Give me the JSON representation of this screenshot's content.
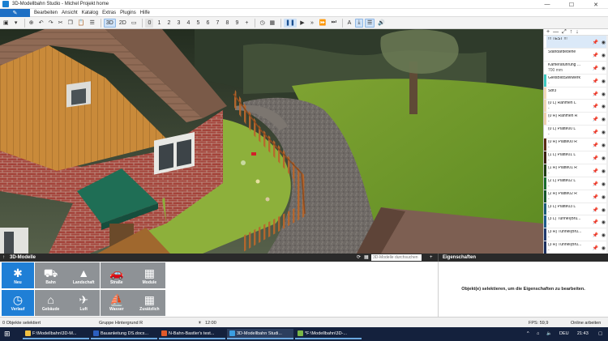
{
  "window": {
    "title": "3D-Modellbahn Studio - Michel Projekt home",
    "controls": [
      "—",
      "☐",
      "✕"
    ]
  },
  "menu": {
    "quick_icon": "pen-icon",
    "items": [
      "Bearbeiten",
      "Ansicht",
      "Katalog",
      "Extras",
      "Plugins",
      "Hilfe"
    ]
  },
  "toolbar": {
    "view_3d": "3D",
    "view_2d": "2D",
    "numbers": [
      "0",
      "1",
      "2",
      "3",
      "4",
      "5",
      "6",
      "7",
      "8",
      "9"
    ],
    "plus": "+"
  },
  "layers": {
    "header_icons": [
      "+",
      "—",
      "⤢",
      "↑",
      "↓"
    ],
    "items": [
      {
        "name": "!!! TEST !!!",
        "sub": "",
        "color": "#ffffff",
        "selected": true
      },
      {
        "name": "Standardebene",
        "sub": "",
        "color": "#ffffff",
        "selected": false
      },
      {
        "name": "Kameraführung ...",
        "sub": "700 mm",
        "color": "#ffffff",
        "selected": false
      },
      {
        "name": "GleisBildStellwerk",
        "sub": "-",
        "color": "#3ec9c0",
        "selected": false
      },
      {
        "name": "Sbf3",
        "sub": "",
        "color": "#f2d9b8",
        "selected": false
      },
      {
        "name": "(0 L) Rahmen L",
        "sub": "-",
        "color": "#f0d6b6",
        "selected": false
      },
      {
        "name": "(0 R) Rahmen R",
        "sub": "-",
        "color": "#f0d0b0",
        "selected": false
      },
      {
        "name": "(0 L) Platte00 L",
        "sub": "-",
        "color": "#ffffff",
        "selected": false
      },
      {
        "name": "(0 R) Platte00 R",
        "sub": "-",
        "color": "#5a2d16",
        "selected": false
      },
      {
        "name": "(1 L) Platte01 L",
        "sub": "-",
        "color": "#3a1f10",
        "selected": false
      },
      {
        "name": "(1 R) Platte01 R",
        "sub": "-",
        "color": "#1f3c14",
        "selected": false
      },
      {
        "name": "(2 L) Platte02 L",
        "sub": "-",
        "color": "#1a6b2e",
        "selected": false
      },
      {
        "name": "(2 R) Platte02 R",
        "sub": "-",
        "color": "#15552a",
        "selected": false
      },
      {
        "name": "(3 L) Platte03 L",
        "sub": "-",
        "color": "#1b5b75",
        "selected": false
      },
      {
        "name": "(3 L) Tunnel(Brü...",
        "sub": "-",
        "color": "#1c5a8a",
        "selected": false
      },
      {
        "name": "(3 R) Tunnel(Brü...",
        "sub": "-",
        "color": "#203a6e",
        "selected": false
      },
      {
        "name": "(3 R) Tunnel(Brü...",
        "sub": "-",
        "color": "#1b2f5e",
        "selected": false
      }
    ]
  },
  "models_panel": {
    "title": "3D-Modelle",
    "search_placeholder": "3D-Modelle durchsuchen",
    "tiles": [
      {
        "label": "Neu",
        "icon": "✱",
        "icon_name": "asterisk-icon",
        "color": "blue"
      },
      {
        "label": "Bahn",
        "icon": "⛟",
        "icon_name": "train-icon",
        "color": "grey"
      },
      {
        "label": "Landschaft",
        "icon": "▲",
        "icon_name": "tree-icon",
        "color": "grey"
      },
      {
        "label": "Straße",
        "icon": "🚗",
        "icon_name": "car-icon",
        "color": "grey"
      },
      {
        "label": "Module",
        "icon": "▦",
        "icon_name": "grid-icon",
        "color": "grey"
      },
      {
        "label": "Verlauf",
        "icon": "◷",
        "icon_name": "clock-icon",
        "color": "blue"
      },
      {
        "label": "Gebäude",
        "icon": "⌂",
        "icon_name": "house-icon",
        "color": "grey"
      },
      {
        "label": "Luft",
        "icon": "✈",
        "icon_name": "plane-icon",
        "color": "grey"
      },
      {
        "label": "Wasser",
        "icon": "⛵",
        "icon_name": "sailboat-icon",
        "color": "grey"
      },
      {
        "label": "Zusätzlich",
        "icon": "▦",
        "icon_name": "grid-icon",
        "color": "grey"
      }
    ]
  },
  "properties_panel": {
    "title": "Eigenschaften",
    "message": "Objekt(e) selektieren, um die Eigenschaften zu bearbeiten."
  },
  "status": {
    "selected": "0 Objekte selektiert",
    "group": "Gruppe Hintergrund R",
    "time": "12:00",
    "fps": "FPS: 59,9",
    "mode": "Online arbeiten"
  },
  "taskbar": {
    "tasks": [
      {
        "label": "F:\\Modellbahn\\3D-M...",
        "color": "#f0c040",
        "active": false
      },
      {
        "label": "Bauanleitung DS.docx...",
        "color": "#2b5fbf",
        "active": false
      },
      {
        "label": "N-Bahn-Bastler's test...",
        "color": "#e05a2a",
        "active": false
      },
      {
        "label": "3D-Modellbahn Studi...",
        "color": "#3b9ee0",
        "active": true
      },
      {
        "label": "*F:\\Modellbahn\\3D-...",
        "color": "#7ab648",
        "active": false
      }
    ],
    "lang": "DEU",
    "clock": "21:43"
  }
}
